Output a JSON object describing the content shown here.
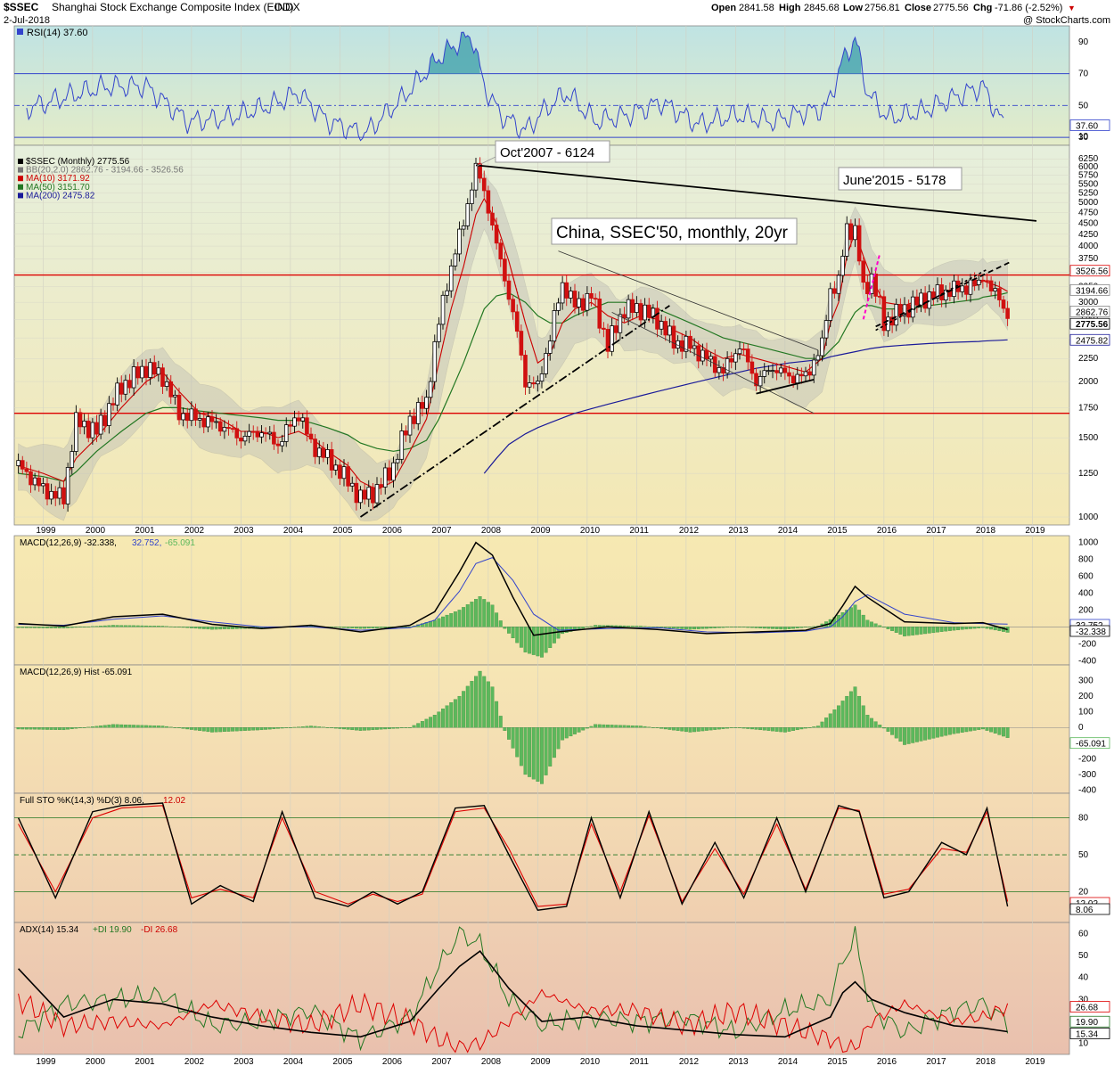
{
  "header": {
    "symbol": "$SSEC",
    "name": "Shanghai Stock Exchange Composite Index (EOD)",
    "exchange": "INDX",
    "date": "2-Jul-2018",
    "copyright": "@ StockCharts.com",
    "quote": {
      "open_label": "Open",
      "open": "2841.58",
      "high_label": "High",
      "high": "2845.68",
      "low_label": "Low",
      "low": "2756.81",
      "close_label": "Close",
      "close": "2775.56",
      "chg_label": "Chg",
      "chg": "-71.86 (-2.52%)",
      "down_arrow": "▼"
    }
  },
  "colors": {
    "candle_up": "#000000",
    "candle_down": "#d01010",
    "ma10": "#cc0000",
    "ma50": "#227722",
    "ma200": "#1a1a99",
    "rsi": "#3344cc",
    "hist": "#5cb85c",
    "hline": "#dd0000",
    "pink": "#ff00cc"
  },
  "chart_data": [
    {
      "id": "rsi",
      "type": "line",
      "title": "RSI(14) 37.60",
      "series": [
        {
          "name": "RSI(14)",
          "last": 37.6
        }
      ],
      "ylim": [
        25,
        100
      ],
      "y_ticks": [
        "90",
        "70",
        "50",
        "30",
        "10"
      ],
      "last_label": "37.60",
      "x": [
        "1998-09",
        "1999-06",
        "2000-04",
        "2001-02",
        "2001-12",
        "2002-10",
        "2003-08",
        "2004-03",
        "2004-10",
        "2005-07",
        "2006-04",
        "2007-01",
        "2007-05",
        "2007-09",
        "2007-12",
        "2008-04",
        "2008-10",
        "2009-03",
        "2009-08",
        "2010-03",
        "2010-11",
        "2011-07",
        "2012-04",
        "2013-01",
        "2013-10",
        "2014-06",
        "2014-11",
        "2015-03",
        "2015-06",
        "2015-09",
        "2016-02",
        "2016-10",
        "2017-06",
        "2018-01",
        "2018-06"
      ],
      "values": [
        48,
        55,
        62,
        62,
        40,
        42,
        50,
        58,
        40,
        32,
        54,
        80,
        88,
        94,
        62,
        44,
        34,
        48,
        58,
        40,
        44,
        52,
        38,
        44,
        40,
        46,
        48,
        78,
        92,
        58,
        42,
        46,
        55,
        62,
        37.6
      ]
    },
    {
      "id": "price",
      "type": "candlestick",
      "title": "$SSEC (Monthly) 2775.56",
      "legend": [
        {
          "text": "$SSEC (Monthly) 2775.56",
          "color": "#000000"
        },
        {
          "text": "BB(20,2.0) 2862.76 - 3194.66 - 3526.56",
          "color": "#777777"
        },
        {
          "text": "MA(10) 3171.92",
          "color": "#cc0000"
        },
        {
          "text": "MA(50) 3151.70",
          "color": "#227722"
        },
        {
          "text": "MA(200) 2475.82",
          "color": "#1a1a99"
        }
      ],
      "y_scale": "log",
      "ylim": [
        960,
        6700
      ],
      "y_ticks": [
        "6250",
        "6000",
        "5750",
        "5500",
        "5250",
        "5000",
        "4750",
        "4500",
        "4250",
        "4000",
        "3750",
        "3500",
        "3250",
        "3000",
        "2750",
        "2500",
        "2250",
        "2000",
        "1750",
        "1500",
        "1250",
        "1000"
      ],
      "price_labels": [
        "3526.56",
        "3194.66",
        "2862.76",
        "2775.56",
        "2475.82"
      ],
      "x_ticks": [
        "1999",
        "2000",
        "2001",
        "2002",
        "2003",
        "2004",
        "2005",
        "2006",
        "2007",
        "2008",
        "2009",
        "2010",
        "2011",
        "2012",
        "2013",
        "2014",
        "2015",
        "2016",
        "2017",
        "2018",
        "2019"
      ],
      "x": [
        "1998-07",
        "1999-01",
        "1999-06",
        "1999-09",
        "2000-02",
        "2000-08",
        "2001-02",
        "2001-06",
        "2001-10",
        "2002-03",
        "2002-08",
        "2003-01",
        "2003-06",
        "2003-10",
        "2004-03",
        "2004-06",
        "2004-10",
        "2005-03",
        "2005-06",
        "2005-10",
        "2006-02",
        "2006-06",
        "2006-10",
        "2007-01",
        "2007-04",
        "2007-07",
        "2007-10",
        "2007-12",
        "2008-03",
        "2008-06",
        "2008-10",
        "2009-01",
        "2009-04",
        "2009-07",
        "2009-10",
        "2010-02",
        "2010-06",
        "2010-10",
        "2011-02",
        "2011-06",
        "2011-10",
        "2012-02",
        "2012-06",
        "2012-10",
        "2013-02",
        "2013-06",
        "2013-10",
        "2014-02",
        "2014-06",
        "2014-10",
        "2014-12",
        "2015-02",
        "2015-04",
        "2015-06",
        "2015-08",
        "2015-10",
        "2016-01",
        "2016-06",
        "2016-12",
        "2017-06",
        "2017-12",
        "2018-01",
        "2018-03",
        "2018-05",
        "2018-07"
      ],
      "close": [
        1300,
        1150,
        1100,
        1630,
        1550,
        1950,
        2150,
        2050,
        1700,
        1650,
        1600,
        1500,
        1550,
        1450,
        1700,
        1450,
        1350,
        1200,
        1100,
        1150,
        1300,
        1650,
        1800,
        2700,
        3600,
        4500,
        5950,
        5300,
        4000,
        3100,
        2000,
        1950,
        2500,
        3300,
        2950,
        3100,
        2400,
        2900,
        2900,
        2750,
        2450,
        2400,
        2250,
        2100,
        2400,
        2000,
        2150,
        2050,
        2050,
        2400,
        3200,
        3300,
        4400,
        4300,
        3200,
        3400,
        2700,
        2900,
        3100,
        3200,
        3300,
        3480,
        3170,
        3100,
        2775.56
      ],
      "ma10": [
        1300,
        1250,
        1200,
        1350,
        1500,
        1750,
        2000,
        2100,
        1900,
        1700,
        1650,
        1550,
        1550,
        1500,
        1550,
        1500,
        1400,
        1300,
        1200,
        1150,
        1200,
        1400,
        1650,
        2200,
        2900,
        3600,
        4700,
        5100,
        4500,
        3700,
        2700,
        2200,
        2300,
        2700,
        2900,
        3000,
        2800,
        2700,
        2800,
        2750,
        2600,
        2500,
        2350,
        2250,
        2300,
        2250,
        2200,
        2150,
        2100,
        2250,
        2700,
        3000,
        3800,
        4300,
        3800,
        3400,
        3000,
        2950,
        3100,
        3200,
        3280,
        3350,
        3300,
        3250,
        3171.92
      ],
      "ma50": [
        1250,
        1230,
        1200,
        1260,
        1400,
        1550,
        1700,
        1750,
        1750,
        1720,
        1700,
        1680,
        1660,
        1640,
        1640,
        1620,
        1580,
        1520,
        1460,
        1420,
        1400,
        1420,
        1480,
        1650,
        1900,
        2200,
        2600,
        2900,
        3100,
        3150,
        3000,
        2800,
        2700,
        2700,
        2800,
        2900,
        3000,
        3000,
        2950,
        2900,
        2800,
        2700,
        2600,
        2500,
        2450,
        2400,
        2350,
        2300,
        2250,
        2250,
        2350,
        2450,
        2650,
        2850,
        2950,
        2950,
        2900,
        2900,
        2950,
        3000,
        3050,
        3080,
        3100,
        3120,
        3151.7
      ],
      "ma200": [
        null,
        null,
        null,
        null,
        null,
        null,
        null,
        null,
        null,
        null,
        null,
        null,
        null,
        null,
        null,
        null,
        null,
        null,
        null,
        null,
        null,
        null,
        null,
        null,
        null,
        null,
        null,
        1250,
        1350,
        1450,
        1530,
        1580,
        1620,
        1660,
        1700,
        1740,
        1780,
        1820,
        1860,
        1900,
        1940,
        1980,
        2020,
        2060,
        2100,
        2140,
        2170,
        2200,
        2220,
        2240,
        2270,
        2290,
        2310,
        2330,
        2350,
        2370,
        2390,
        2410,
        2430,
        2445,
        2455,
        2460,
        2465,
        2470,
        2475.82
      ],
      "hlines": [
        3450,
        1700
      ],
      "annotations": [
        {
          "text": "Oct'2007 - 6124",
          "x": "2007-10",
          "y": 6124
        },
        {
          "text": "June'2015 - 5178",
          "x": "2015-06",
          "y": 5178
        },
        {
          "text": "China, SSEC'50, monthly, 20yr"
        }
      ],
      "trendlines": [
        {
          "style": "solid",
          "from": [
            "2007-10",
            6050
          ],
          "to": [
            "2019-02",
            4550
          ]
        },
        {
          "style": "dash-dot",
          "from": [
            "2005-06",
            1000
          ],
          "to": [
            "2011-09",
            2950
          ]
        },
        {
          "style": "solid-thin",
          "from": [
            "2009-06",
            3900
          ],
          "to": [
            "2014-09",
            2350
          ]
        },
        {
          "style": "solid-thin",
          "from": [
            "2010-07",
            2850
          ],
          "to": [
            "2014-08",
            1700
          ]
        },
        {
          "style": "dashed",
          "from": [
            "2015-11",
            2650
          ],
          "to": [
            "2018-08",
            3700
          ]
        },
        {
          "style": "solid",
          "from": [
            "2013-06",
            1880
          ],
          "to": [
            "2014-08",
            2020
          ]
        }
      ]
    },
    {
      "id": "macd",
      "type": "line",
      "title": "MACD(12,26,9) -32.338, 32.752, -65.091",
      "title_parts": {
        "main": "MACD(12,26,9) -32.338,",
        "signal": "32.752,",
        "hist": "-65.091"
      },
      "ylim": [
        -450,
        1080
      ],
      "y_ticks": [
        "1000",
        "800",
        "600",
        "400",
        "200",
        "0",
        "-200",
        "-400"
      ],
      "last_labels": [
        "32.752",
        "-32.338"
      ],
      "x": [
        "1998-07",
        "1999-06",
        "2000-06",
        "2001-06",
        "2002-06",
        "2003-06",
        "2004-06",
        "2005-06",
        "2006-06",
        "2006-12",
        "2007-06",
        "2007-10",
        "2008-02",
        "2008-07",
        "2008-12",
        "2009-06",
        "2010-06",
        "2011-06",
        "2012-06",
        "2013-06",
        "2014-06",
        "2014-12",
        "2015-03",
        "2015-06",
        "2015-09",
        "2016-06",
        "2017-06",
        "2018-01",
        "2018-07"
      ],
      "macd": [
        40,
        10,
        120,
        150,
        30,
        -20,
        20,
        -60,
        20,
        180,
        650,
        1000,
        850,
        350,
        -100,
        -60,
        0,
        -30,
        -80,
        -60,
        -40,
        40,
        250,
        480,
        350,
        60,
        40,
        50,
        -32.338
      ],
      "signal": [
        30,
        20,
        90,
        130,
        60,
        0,
        0,
        -40,
        -10,
        80,
        420,
        750,
        820,
        550,
        150,
        -40,
        -20,
        -10,
        -60,
        -70,
        -50,
        0,
        120,
        300,
        380,
        150,
        50,
        40,
        32.752
      ]
    },
    {
      "id": "hist",
      "type": "bar",
      "title": "MACD(12,26,9) Hist -65.091",
      "ylim": [
        -420,
        400
      ],
      "y_ticks": [
        "300",
        "200",
        "100",
        "0",
        "-100",
        "-200",
        "-300",
        "-400"
      ],
      "last_label": "-65.091",
      "x": [
        "1998-07",
        "1999-06",
        "2000-06",
        "2001-06",
        "2002-06",
        "2003-06",
        "2004-06",
        "2005-06",
        "2006-06",
        "2006-12",
        "2007-06",
        "2007-11",
        "2008-02",
        "2008-05",
        "2008-10",
        "2009-02",
        "2009-07",
        "2010-03",
        "2011-02",
        "2012-02",
        "2013-01",
        "2014-01",
        "2014-09",
        "2015-02",
        "2015-06",
        "2015-09",
        "2016-06",
        "2017-06",
        "2018-01",
        "2018-07"
      ],
      "values": [
        -10,
        -15,
        20,
        10,
        -30,
        -15,
        10,
        -20,
        0,
        80,
        200,
        360,
        260,
        -20,
        -300,
        -360,
        -80,
        20,
        10,
        -30,
        0,
        -30,
        10,
        140,
        260,
        80,
        -110,
        -40,
        -10,
        -65.091
      ]
    },
    {
      "id": "sto",
      "type": "line",
      "title": "Full STO %K(14,3) %D(3) 8.06, 12.02",
      "title_parts": {
        "main": "Full STO %K(14,3) %D(3) 8.06,",
        "d": "12.02"
      },
      "ylim": [
        -5,
        100
      ],
      "y_ticks": [
        "80",
        "50",
        "20"
      ],
      "last_labels": [
        "12.02",
        "8.06"
      ],
      "x": [
        "1998-07",
        "1999-04",
        "2000-01",
        "2000-08",
        "2001-06",
        "2002-01",
        "2002-08",
        "2003-04",
        "2003-11",
        "2004-07",
        "2005-03",
        "2005-09",
        "2006-03",
        "2006-09",
        "2007-05",
        "2007-12",
        "2008-06",
        "2009-01",
        "2009-08",
        "2010-02",
        "2010-09",
        "2011-04",
        "2011-12",
        "2012-08",
        "2013-03",
        "2013-11",
        "2014-06",
        "2015-02",
        "2015-07",
        "2016-01",
        "2016-07",
        "2017-03",
        "2017-09",
        "2018-02",
        "2018-07"
      ],
      "k": [
        80,
        15,
        85,
        90,
        92,
        10,
        25,
        12,
        85,
        15,
        8,
        20,
        10,
        20,
        88,
        90,
        50,
        5,
        8,
        80,
        15,
        85,
        10,
        60,
        15,
        80,
        20,
        90,
        85,
        15,
        20,
        60,
        50,
        88,
        8.06
      ],
      "d": [
        75,
        20,
        80,
        88,
        90,
        15,
        22,
        15,
        80,
        20,
        10,
        18,
        12,
        18,
        85,
        88,
        55,
        8,
        10,
        75,
        20,
        82,
        12,
        55,
        18,
        75,
        22,
        88,
        86,
        18,
        22,
        55,
        52,
        85,
        12.02
      ]
    },
    {
      "id": "adx",
      "type": "line",
      "title": "ADX(14) 15.34 +DI 19.90 -DI 26.68",
      "title_parts": {
        "adx": "ADX(14) 15.34",
        "plus": "+DI 19.90",
        "minus": "-DI 26.68"
      },
      "ylim": [
        5,
        65
      ],
      "y_ticks": [
        "60",
        "50",
        "40",
        "30",
        "20",
        "10"
      ],
      "last_labels": [
        "26.68",
        "19.90",
        "15.34"
      ],
      "x": [
        "1998-07",
        "1999-06",
        "2000-06",
        "2001-06",
        "2002-06",
        "2003-06",
        "2004-06",
        "2005-06",
        "2006-06",
        "2007-01",
        "2007-06",
        "2007-11",
        "2008-06",
        "2009-02",
        "2010-01",
        "2011-01",
        "2012-01",
        "2013-01",
        "2014-01",
        "2014-12",
        "2015-03",
        "2015-06",
        "2015-10",
        "2016-06",
        "2017-06",
        "2018-01",
        "2018-07"
      ],
      "adx": [
        44,
        22,
        30,
        28,
        22,
        18,
        15,
        13,
        20,
        35,
        45,
        52,
        35,
        20,
        22,
        18,
        16,
        14,
        13,
        22,
        33,
        38,
        30,
        24,
        18,
        17,
        15.34
      ],
      "plus_di": [
        15,
        28,
        30,
        32,
        18,
        20,
        25,
        12,
        22,
        45,
        60,
        55,
        30,
        18,
        22,
        20,
        22,
        15,
        25,
        30,
        48,
        58,
        25,
        15,
        25,
        28,
        19.9
      ],
      "minus_di": [
        30,
        18,
        20,
        18,
        28,
        22,
        18,
        28,
        20,
        12,
        8,
        10,
        20,
        33,
        25,
        25,
        18,
        25,
        18,
        12,
        8,
        8,
        20,
        28,
        20,
        22,
        26.68
      ]
    }
  ]
}
